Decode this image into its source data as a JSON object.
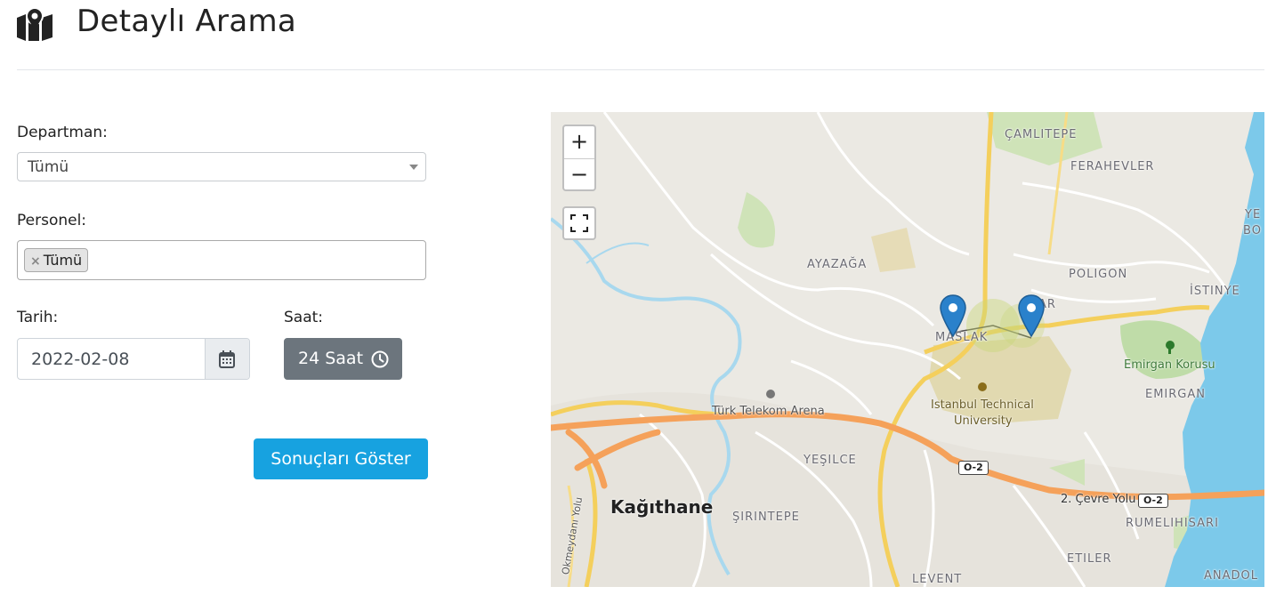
{
  "header": {
    "title": "Detaylı Arama",
    "icon": "map-marked-icon"
  },
  "form": {
    "department_label": "Departman:",
    "department_value": "Tümü",
    "personnel_label": "Personel:",
    "personnel_tag": "Tümü",
    "date_label": "Tarih:",
    "date_value": "2022-02-08",
    "hour_label": "Saat:",
    "hour_button": "24 Saat",
    "submit_label": "Sonuçları Göster"
  },
  "map": {
    "zoom_in": "+",
    "zoom_out": "−",
    "labels": {
      "camlitepe": "ÇAMLITEPE",
      "ferahevler": "FERAHEVLER",
      "ye": "YE",
      "bo": "BO",
      "ayazaga": "AYAZAĞA",
      "poligon": "POLIGON",
      "istinye": "İSTINYE",
      "maslak": "MASLAK",
      "ar": "AR",
      "emirgan_korusu": "Emirgan Korusu",
      "emirgan": "EMIRGAN",
      "arena": "Türk Telekom Arena",
      "itu": "Istanbul Technical",
      "itu2": "University",
      "yesilce": "YEŞILCE",
      "kagithane": "Kağıthane",
      "sirintepe": "ŞIRINTEPE",
      "cevre": "2. Çevre Yolu",
      "rumelihisari": "RUMELIHISARI",
      "etiler": "ETILER",
      "levent": "LEVENT",
      "anadol": "ANADOL",
      "okmeydani": "Okmeydanı Yolu",
      "o2_a": "O-2",
      "o2_b": "O-2"
    },
    "markers": 2
  },
  "colors": {
    "primary": "#17a2e0",
    "secondary": "#6c757d",
    "marker": "#2a81cb"
  }
}
